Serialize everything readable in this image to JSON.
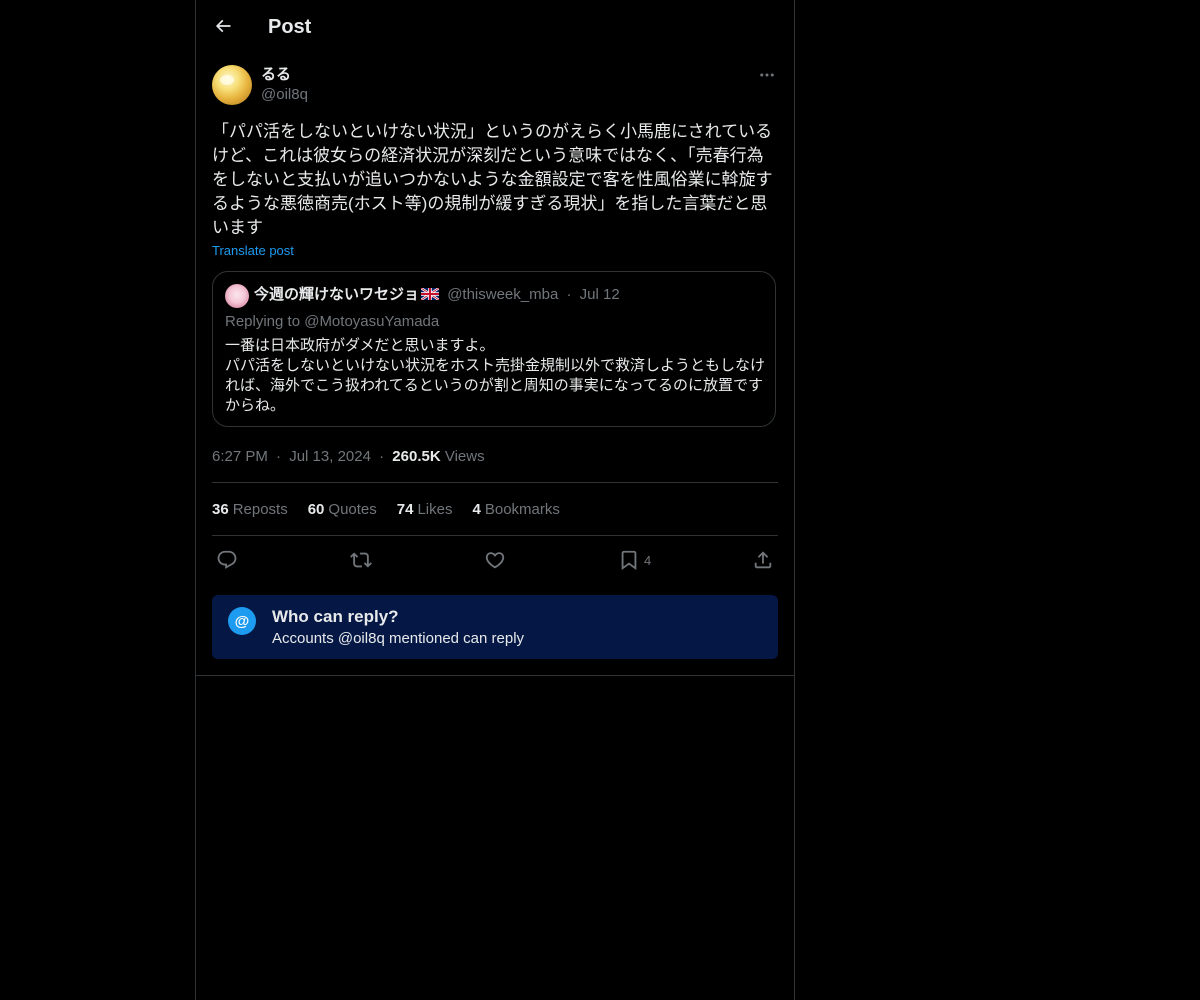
{
  "header": {
    "title": "Post"
  },
  "post": {
    "author_name": "るる",
    "author_handle": "@oil8q",
    "text": "「パパ活をしないといけない状況」というのがえらく小馬鹿にされているけど、これは彼女らの経済状況が深刻だという意味ではなく、「売春行為をしないと支払いが追いつかないような金額設定で客を性風俗業に斡旋するような悪徳商売(ホスト等)の規制が緩すぎる現状」を指した言葉だと思います",
    "translate_label": "Translate post",
    "time": "6:27 PM",
    "date": "Jul 13, 2024",
    "views_count": "260.5K",
    "views_label": "Views",
    "sep": "·"
  },
  "quote": {
    "author_name": "今週の輝けないワセジョ",
    "author_handle": "@thisweek_mba",
    "date": "Jul 12",
    "sep": "·",
    "replying_to": "Replying to @MotoyasuYamada",
    "text": "一番は日本政府がダメだと思いますよ。\nパパ活をしないといけない状況をホスト売掛金規制以外で救済しようともしなければ、海外でこう扱われてるというのが割と周知の事実になってるのに放置ですからね。"
  },
  "stats": {
    "reposts_count": "36",
    "reposts_label": "Reposts",
    "quotes_count": "60",
    "quotes_label": "Quotes",
    "likes_count": "74",
    "likes_label": "Likes",
    "bookmarks_count": "4",
    "bookmarks_label": "Bookmarks"
  },
  "actions": {
    "bookmark_count": "4"
  },
  "reply_notice": {
    "icon_glyph": "@",
    "title": "Who can reply?",
    "subtitle": "Accounts @oil8q mentioned can reply"
  },
  "colors": {
    "background": "#000000",
    "text_primary": "#e7e9ea",
    "text_secondary": "#71767b",
    "accent": "#1d9bf0",
    "border": "#2f3336",
    "notice_bg": "#051845"
  },
  "icons": {
    "back": "arrow-left-icon",
    "more": "more-horizontal-icon",
    "reply": "reply-icon",
    "repost": "repost-icon",
    "like": "heart-icon",
    "bookmark": "bookmark-icon",
    "share": "share-icon",
    "flag": "uk-flag-icon"
  }
}
